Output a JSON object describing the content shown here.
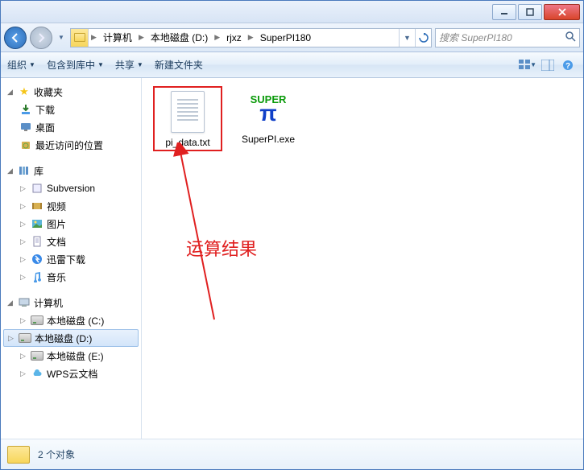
{
  "breadcrumb": {
    "segments": [
      "计算机",
      "本地磁盘 (D:)",
      "rjxz",
      "SuperPI180"
    ]
  },
  "search": {
    "placeholder": "搜索 SuperPI180"
  },
  "toolbar": {
    "organize": "组织",
    "include": "包含到库中",
    "share": "共享",
    "newfolder": "新建文件夹"
  },
  "sidebar": {
    "favorites": {
      "label": "收藏夹",
      "items": [
        {
          "label": "下载",
          "icon": "download"
        },
        {
          "label": "桌面",
          "icon": "desktop"
        },
        {
          "label": "最近访问的位置",
          "icon": "recent"
        }
      ]
    },
    "libraries": {
      "label": "库",
      "items": [
        {
          "label": "Subversion",
          "icon": "svn"
        },
        {
          "label": "视频",
          "icon": "video"
        },
        {
          "label": "图片",
          "icon": "picture"
        },
        {
          "label": "文档",
          "icon": "document"
        },
        {
          "label": "迅雷下载",
          "icon": "xunlei"
        },
        {
          "label": "音乐",
          "icon": "music"
        }
      ]
    },
    "computer": {
      "label": "计算机",
      "items": [
        {
          "label": "本地磁盘 (C:)",
          "icon": "drive"
        },
        {
          "label": "本地磁盘 (D:)",
          "icon": "drive",
          "selected": true
        },
        {
          "label": "本地磁盘 (E:)",
          "icon": "drive"
        },
        {
          "label": "WPS云文档",
          "icon": "cloud"
        }
      ]
    }
  },
  "files": [
    {
      "name": "pi_data.txt",
      "type": "txt",
      "highlighted": true
    },
    {
      "name": "SuperPI.exe",
      "type": "exe"
    }
  ],
  "annotation": {
    "text": "运算结果"
  },
  "statusbar": {
    "text": "2 个对象"
  }
}
